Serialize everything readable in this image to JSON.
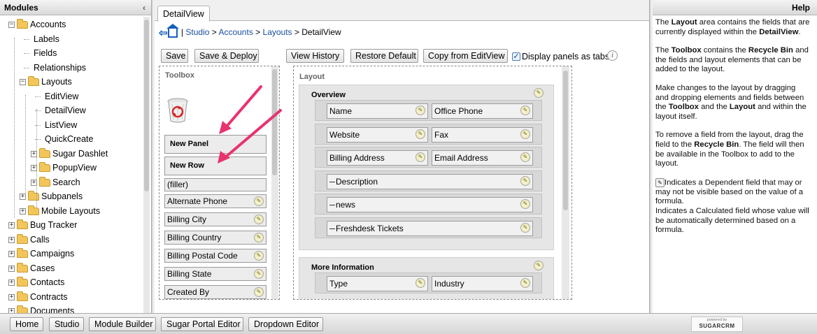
{
  "modules_panel": {
    "title": "Modules",
    "collapse_icon": "chevron-left-icon",
    "tree": [
      {
        "label": "Accounts",
        "toggle": "−",
        "folder": true
      },
      {
        "label": "Labels"
      },
      {
        "label": "Fields"
      },
      {
        "label": "Relationships"
      },
      {
        "label": "Layouts",
        "toggle": "−",
        "folder": true
      },
      {
        "label": "EditView"
      },
      {
        "label": "DetailView"
      },
      {
        "label": "ListView"
      },
      {
        "label": "QuickCreate"
      },
      {
        "label": "Sugar Dashlet",
        "toggle": "+",
        "folder": true
      },
      {
        "label": "PopupView",
        "toggle": "+",
        "folder": true
      },
      {
        "label": "Search",
        "toggle": "+",
        "folder": true
      },
      {
        "label": "Subpanels",
        "toggle": "+",
        "folder": true
      },
      {
        "label": "Mobile Layouts",
        "toggle": "+",
        "folder": true
      },
      {
        "label": "Bug Tracker",
        "toggle": "+",
        "folder": true
      },
      {
        "label": "Calls",
        "toggle": "+",
        "folder": true
      },
      {
        "label": "Campaigns",
        "toggle": "+",
        "folder": true
      },
      {
        "label": "Cases",
        "toggle": "+",
        "folder": true
      },
      {
        "label": "Contacts",
        "toggle": "+",
        "folder": true
      },
      {
        "label": "Contracts",
        "toggle": "+",
        "folder": true
      },
      {
        "label": "Documents",
        "toggle": "+",
        "folder": true
      }
    ]
  },
  "center": {
    "tab": "DetailView",
    "breadcrumb": {
      "sep": "|",
      "studio": "Studio",
      "accounts": "Accounts",
      "layouts": "Layouts",
      "current": "DetailView",
      "gt": ">"
    },
    "buttons": {
      "save": "Save",
      "save_deploy": "Save & Deploy",
      "view_history": "View History",
      "restore_default": "Restore Default",
      "copy_from_editview": "Copy from EditView"
    },
    "display_tabs_label": "Display panels as tabs",
    "display_tabs_checked": true,
    "info_icon": "i"
  },
  "toolbox": {
    "title": "Toolbox",
    "recycle_bin_icon": "recycle-bin-icon",
    "new_panel": "New Panel",
    "new_row": "New Row",
    "filler": "(filler)",
    "fields": [
      "Alternate Phone",
      "Billing City",
      "Billing Country",
      "Billing Postal Code",
      "Billing State",
      "Created By"
    ]
  },
  "layout": {
    "title": "Layout",
    "panels": [
      {
        "name": "Overview",
        "rows": [
          [
            "Name",
            "Office Phone"
          ],
          [
            "Website",
            "Fax"
          ],
          [
            "Billing Address",
            "Email Address"
          ],
          [
            "Description"
          ],
          [
            "news"
          ],
          [
            "Freshdesk Tickets"
          ]
        ]
      },
      {
        "name": "More Information",
        "rows": [
          [
            "Type",
            "Industry"
          ]
        ]
      }
    ]
  },
  "help": {
    "title": "Help",
    "p1_a": "The ",
    "p1_b": "Layout",
    "p1_c": " area contains the fields that are currently displayed within the ",
    "p1_d": "DetailView",
    "p1_e": ".",
    "p2_a": "The ",
    "p2_b": "Toolbox",
    "p2_c": " contains the ",
    "p2_d": "Recycle Bin",
    "p2_e": " and the fields and layout elements that can be added to the layout.",
    "p3_a": "Make changes to the layout by dragging and dropping elements and fields between the ",
    "p3_b": "Toolbox",
    "p3_c": " and the ",
    "p3_d": "Layout",
    "p3_e": " and within the layout itself.",
    "p4_a": "To remove a field from the layout, drag the field to the ",
    "p4_b": "Recycle Bin",
    "p4_c": ". The field will then be available in the Toolbox to add to the layout.",
    "p5_a": "Indicates a Dependent field that may or may not be visible based on the value of a formula.",
    "p5_b": "Indicates a Calculated field whose value will be automatically determined based on a formula."
  },
  "footer": {
    "buttons": [
      "Home",
      "Studio",
      "Module Builder",
      "Sugar Portal Editor",
      "Dropdown Editor"
    ],
    "logo_small": "powered by",
    "logo_big": "SUGARCRM"
  },
  "colors": {
    "link": "#1a4e9b",
    "annotation_arrow": "#e8336d"
  }
}
